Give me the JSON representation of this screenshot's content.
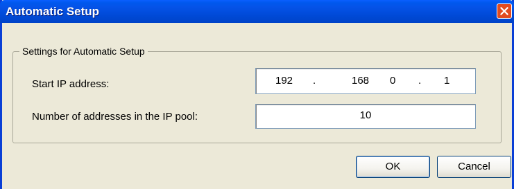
{
  "window": {
    "title": "Automatic Setup"
  },
  "group": {
    "legend": "Settings for Automatic Setup"
  },
  "fields": {
    "start_ip_label": "Start IP address:",
    "start_ip": [
      "192",
      "168",
      "0",
      "1"
    ],
    "ip_separator": ".",
    "pool_label": "Number of addresses in the IP pool:",
    "pool_value": "10"
  },
  "buttons": {
    "ok_label": "OK",
    "cancel_label": "Cancel"
  },
  "icons": {
    "close": "close-icon"
  },
  "colors": {
    "titlebar": "#0053e6",
    "close_button": "#e24b20",
    "dialog_bg": "#ece9d8"
  }
}
